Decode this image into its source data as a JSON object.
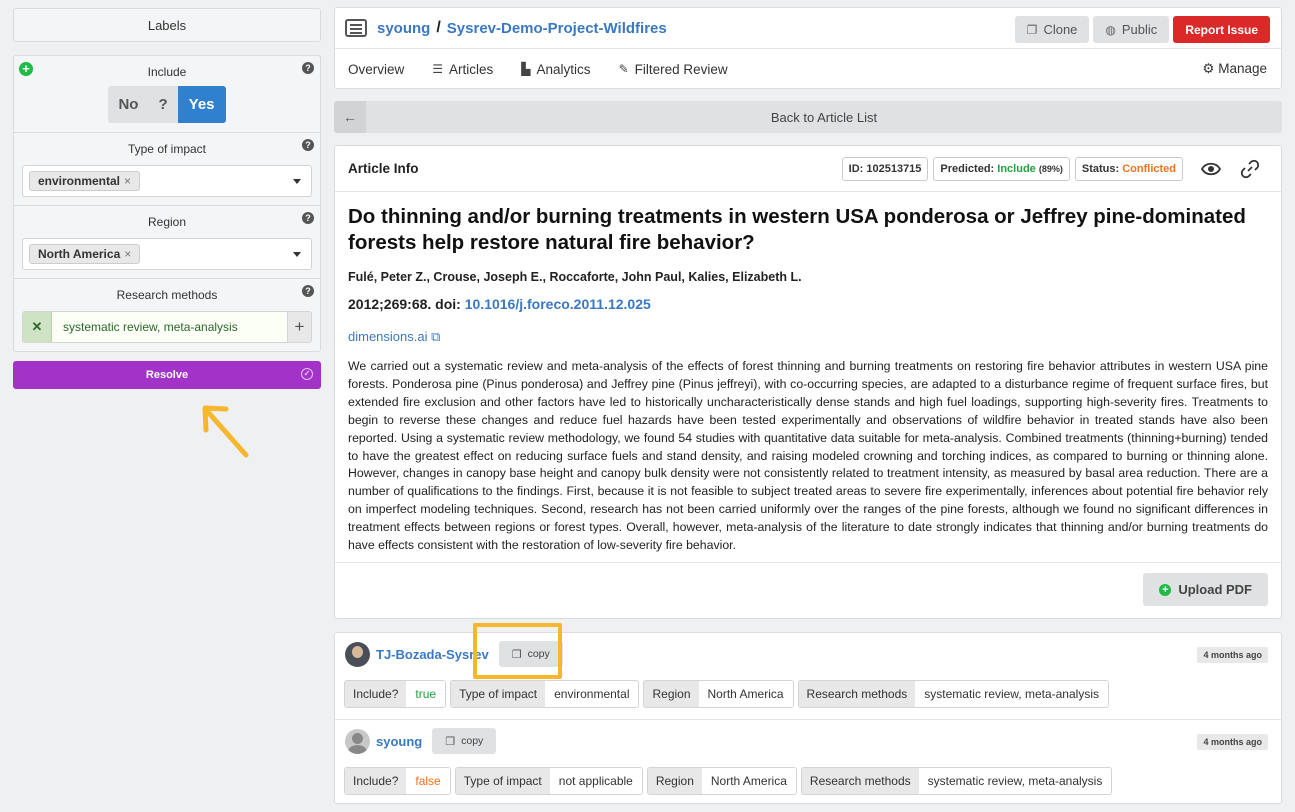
{
  "left_panel": {
    "labels_title": "Labels",
    "include": {
      "title": "Include",
      "options": [
        "No",
        "?",
        "Yes"
      ],
      "selected": "Yes"
    },
    "type_of_impact": {
      "title": "Type of impact",
      "chip": "environmental"
    },
    "region": {
      "title": "Region",
      "chip": "North America"
    },
    "research_methods": {
      "title": "Research methods",
      "value": "systematic review, meta-analysis"
    },
    "resolve_label": "Resolve",
    "help_glyph": "?",
    "remove_glyph": "×"
  },
  "header": {
    "owner": "syoung",
    "separator": "/",
    "project": "Sysrev-Demo-Project-Wildfires",
    "buttons": {
      "clone": "Clone",
      "public": "Public",
      "report": "Report Issue"
    },
    "nav": {
      "overview": "Overview",
      "articles": "Articles",
      "analytics": "Analytics",
      "filtered_review": "Filtered Review",
      "manage": "Manage"
    }
  },
  "back_label": "Back to Article List",
  "article": {
    "section_title": "Article Info",
    "id_badge": "ID: 102513715",
    "predicted_label": "Predicted:",
    "predicted_value": "Include",
    "predicted_pct": "(89%)",
    "status_label": "Status:",
    "status_value": "Conflicted",
    "title": "Do thinning and/or burning treatments in western USA ponderosa or Jeffrey pine-dominated forests help restore natural fire behavior?",
    "authors": "Fulé, Peter Z., Crouse, Joseph E., Roccaforte, John Paul, Kalies, Elizabeth L.",
    "citation_prefix": "2012;269:68. doi:",
    "doi": "10.1016/j.foreco.2011.12.025",
    "source_link": "dimensions.ai",
    "abstract": "We carried out a systematic review and meta-analysis of the effects of forest thinning and burning treatments on restoring fire behavior attributes in western USA pine forests. Ponderosa pine (Pinus ponderosa) and Jeffrey pine (Pinus jeffreyi), with co-occurring species, are adapted to a disturbance regime of frequent surface fires, but extended fire exclusion and other factors have led to historically uncharacteristically dense stands and high fuel loadings, supporting high-severity fires. Treatments to begin to reverse these changes and reduce fuel hazards have been tested experimentally and observations of wildfire behavior in treated stands have also been reported. Using a systematic review methodology, we found 54 studies with quantitative data suitable for meta-analysis. Combined treatments (thinning+burning) tended to have the greatest effect on reducing surface fuels and stand density, and raising modeled crowning and torching indices, as compared to burning or thinning alone. However, changes in canopy base height and canopy bulk density were not consistently related to treatment intensity, as measured by basal area reduction. There are a number of qualifications to the findings. First, because it is not feasible to subject treated areas to severe fire experimentally, inferences about potential fire behavior rely on imperfect modeling techniques. Second, research has not been carried uniformly over the ranges of the pine forests, although we found no significant differences in treatment effects between regions or forest types. Overall, however, meta-analysis of the literature to date strongly indicates that thinning and/or burning treatments do have effects consistent with the restoration of low-severity fire behavior.",
    "upload_label": "Upload PDF"
  },
  "answers": [
    {
      "user": "TJ-Bozada-Sysrev",
      "copy_label": "copy",
      "ago": "4 months ago",
      "include_key": "Include?",
      "include_val": "true",
      "impact_key": "Type of impact",
      "impact_val": "environmental",
      "region_key": "Region",
      "region_val": "North America",
      "methods_key": "Research methods",
      "methods_val": "systematic review, meta-analysis"
    },
    {
      "user": "syoung",
      "copy_label": "copy",
      "ago": "4 months ago",
      "include_key": "Include?",
      "include_val": "false",
      "impact_key": "Type of impact",
      "impact_val": "not applicable",
      "region_key": "Region",
      "region_val": "North America",
      "methods_key": "Research methods",
      "methods_val": "systematic review, meta-analysis"
    }
  ],
  "colors": {
    "accent": "#3a78c2",
    "resolve": "#a333c8",
    "report": "#db2828",
    "callout": "#f6b72c"
  }
}
